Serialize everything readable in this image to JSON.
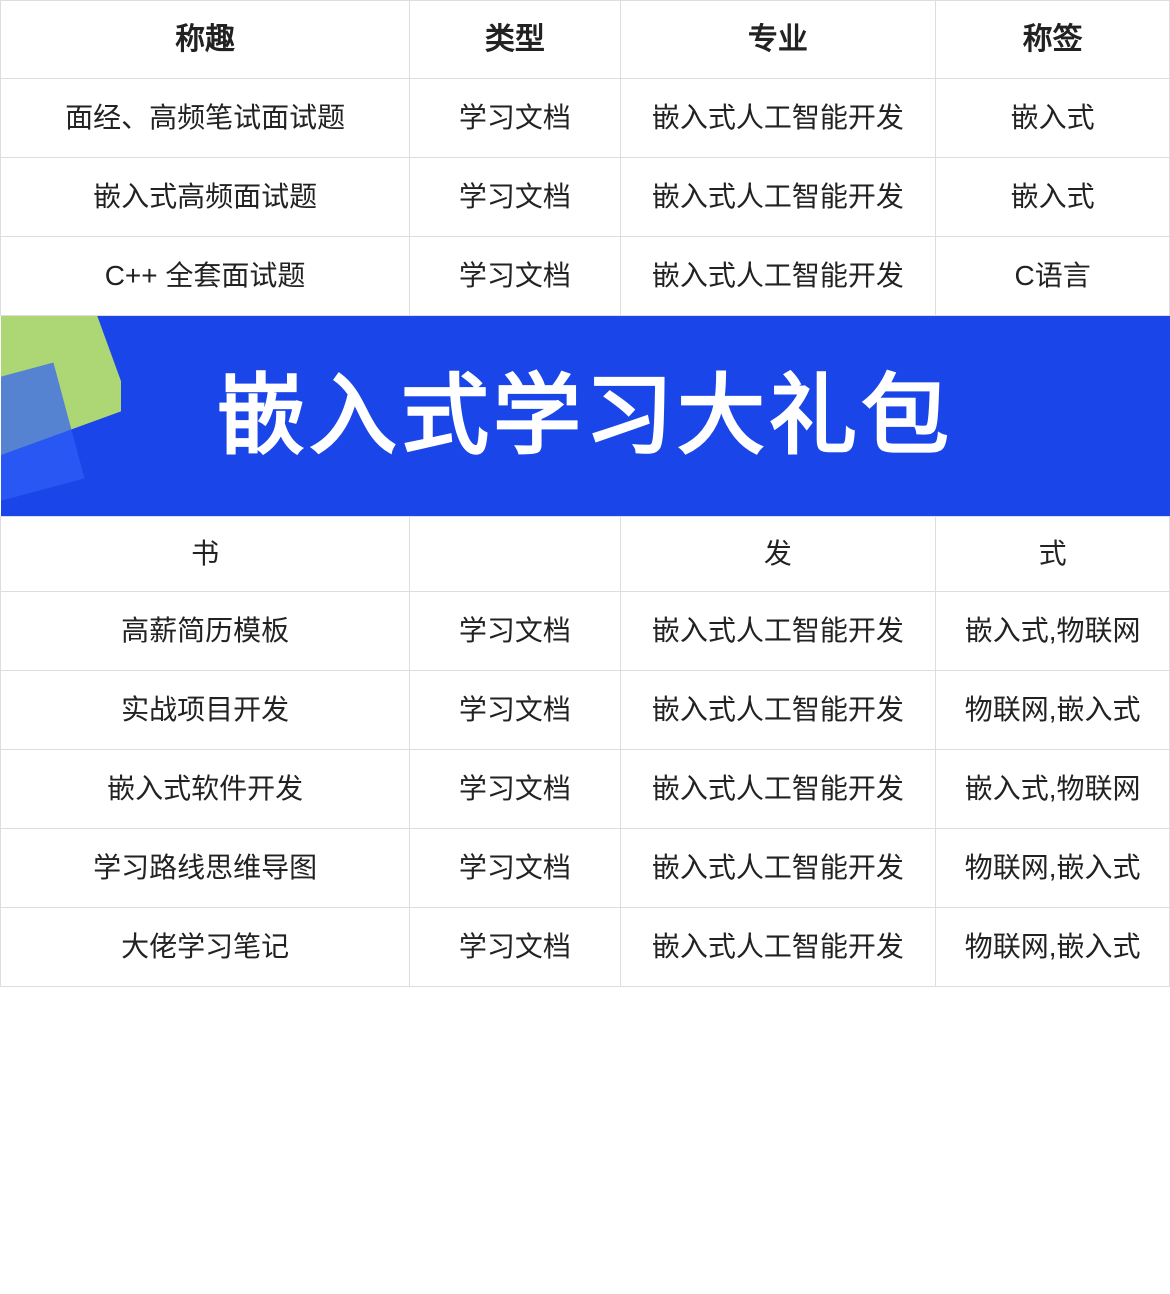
{
  "table": {
    "headers": [
      "称趣",
      "类型",
      "专业",
      "称签"
    ],
    "rows_before_banner": [
      {
        "col1": "面经、高频笔试面试题",
        "col2": "学习文档",
        "col3": "嵌入式人工智能开发",
        "col4": "嵌入式"
      },
      {
        "col1": "嵌入式高频面试题",
        "col2": "学习文档",
        "col3": "嵌入式人工智能开发",
        "col4": "嵌入式"
      },
      {
        "col1": "C++ 全套面试题",
        "col2": "学习文档",
        "col3": "嵌入式人工智能开发",
        "col4": "C语言"
      }
    ],
    "banner": {
      "text": "嵌入式学习大礼包"
    },
    "partial_row": {
      "col1": "书",
      "col3": "发",
      "col4": "式"
    },
    "rows_after_banner": [
      {
        "col1": "高薪简历模板",
        "col2": "学习文档",
        "col3": "嵌入式人工智能开发",
        "col4": "嵌入式,物联网"
      },
      {
        "col1": "实战项目开发",
        "col2": "学习文档",
        "col3": "嵌入式人工智能开发",
        "col4": "物联网,嵌入式"
      },
      {
        "col1": "嵌入式软件开发",
        "col2": "学习文档",
        "col3": "嵌入式人工智能开发",
        "col4": "嵌入式,物联网"
      },
      {
        "col1": "学习路线思维导图",
        "col2": "学习文档",
        "col3": "嵌入式人工智能开发",
        "col4": "物联网,嵌入式"
      },
      {
        "col1": "大佬学习笔记",
        "col2": "学习文档",
        "col3": "嵌入式人工智能开发",
        "col4": "物联网,嵌入式"
      }
    ]
  }
}
